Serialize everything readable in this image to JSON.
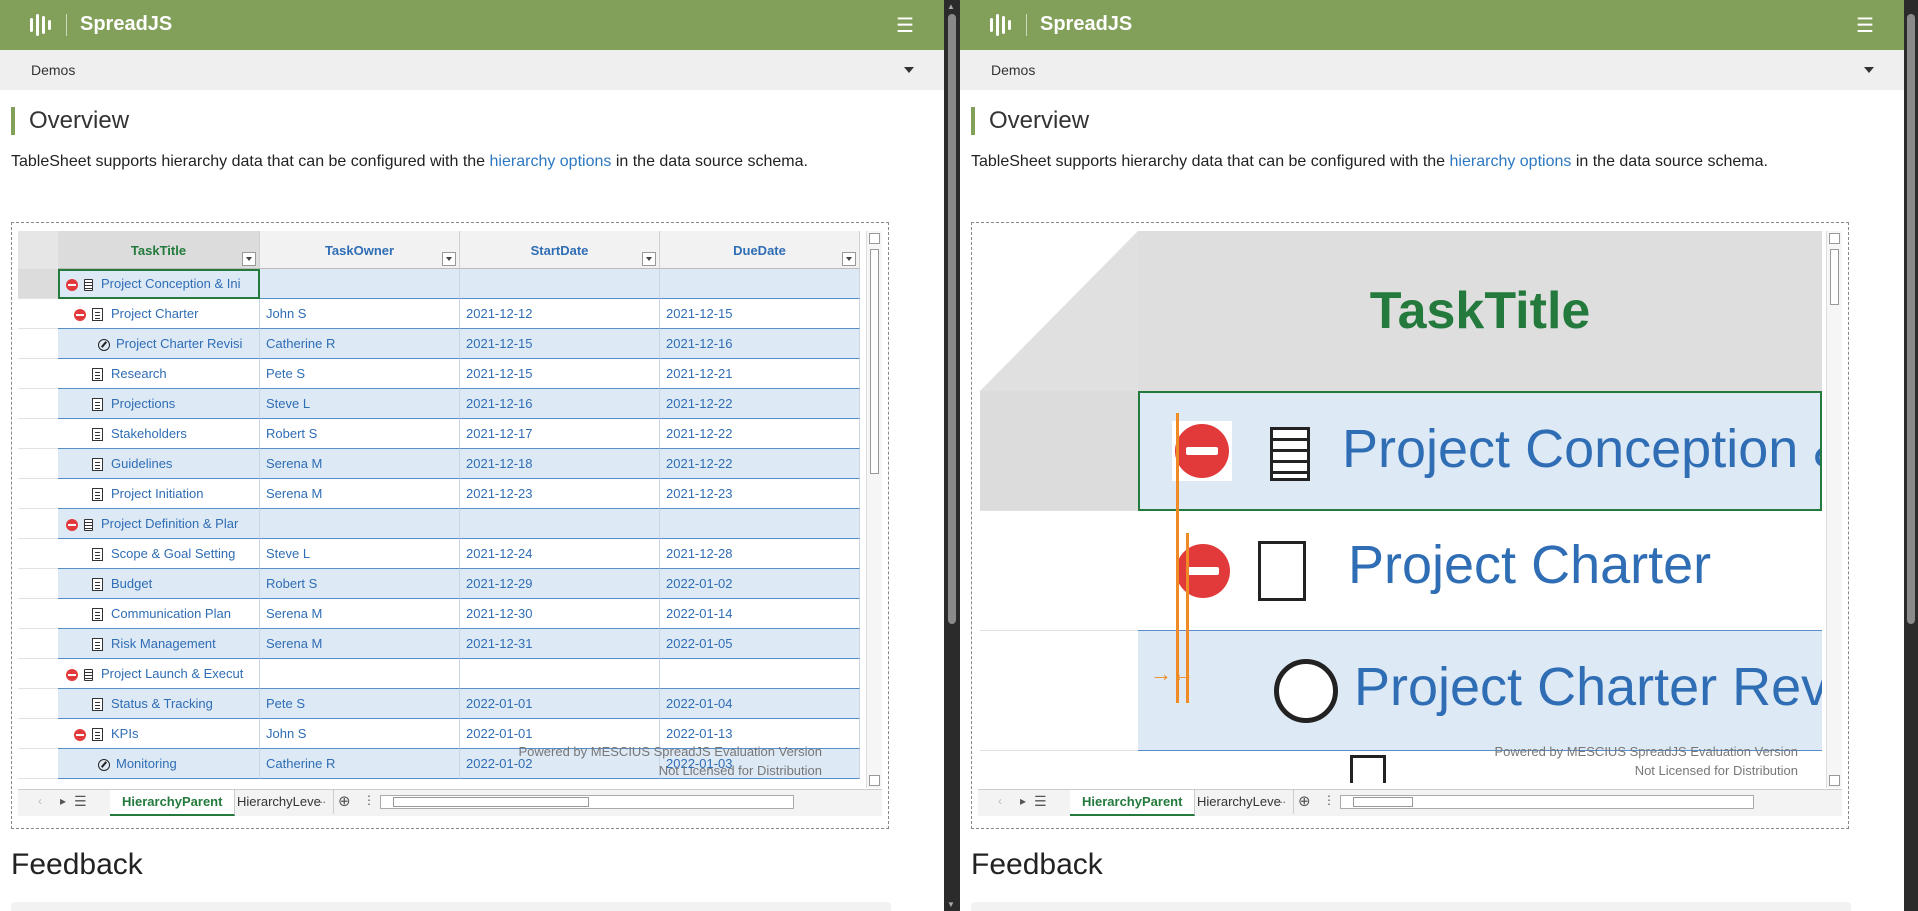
{
  "app": {
    "brand": "SpreadJS",
    "demos_label": "Demos"
  },
  "page": {
    "overview_title": "Overview",
    "desc_before": "TableSheet supports hierarchy data that can be configured with the ",
    "desc_link": "hierarchy options",
    "desc_after": " in the data source schema.",
    "feedback_title": "Feedback"
  },
  "grid": {
    "columns": [
      "TaskTitle",
      "TaskOwner",
      "StartDate",
      "DueDate"
    ],
    "rows": [
      {
        "level": 0,
        "title": "Project Conception & Ini",
        "owner": "",
        "start": "",
        "due": ""
      },
      {
        "level": 1,
        "title": "Project Charter",
        "owner": "John S",
        "start": "2021-12-12",
        "due": "2021-12-15"
      },
      {
        "level": 2,
        "title": "Project Charter Revisi",
        "owner": "Catherine R",
        "start": "2021-12-15",
        "due": "2021-12-16"
      },
      {
        "level": 1,
        "title": "Research",
        "owner": "Pete S",
        "start": "2021-12-15",
        "due": "2021-12-21"
      },
      {
        "level": 1,
        "title": "Projections",
        "owner": "Steve L",
        "start": "2021-12-16",
        "due": "2021-12-22"
      },
      {
        "level": 1,
        "title": "Stakeholders",
        "owner": "Robert S",
        "start": "2021-12-17",
        "due": "2021-12-22"
      },
      {
        "level": 1,
        "title": "Guidelines",
        "owner": "Serena M",
        "start": "2021-12-18",
        "due": "2021-12-22"
      },
      {
        "level": 1,
        "title": "Project Initiation",
        "owner": "Serena M",
        "start": "2021-12-23",
        "due": "2021-12-23"
      },
      {
        "level": 0,
        "title": "Project Definition & Plar",
        "owner": "",
        "start": "",
        "due": ""
      },
      {
        "level": 1,
        "title": "Scope & Goal Setting",
        "owner": "Steve L",
        "start": "2021-12-24",
        "due": "2021-12-28"
      },
      {
        "level": 1,
        "title": "Budget",
        "owner": "Robert S",
        "start": "2021-12-29",
        "due": "2022-01-02"
      },
      {
        "level": 1,
        "title": "Communication Plan",
        "owner": "Serena M",
        "start": "2021-12-30",
        "due": "2022-01-14"
      },
      {
        "level": 1,
        "title": "Risk Management",
        "owner": "Serena M",
        "start": "2021-12-31",
        "due": "2022-01-05"
      },
      {
        "level": 0,
        "title": "Project Launch & Execut",
        "owner": "",
        "start": "",
        "due": ""
      },
      {
        "level": 1,
        "title": "Status & Tracking",
        "owner": "Pete S",
        "start": "2022-01-01",
        "due": "2022-01-04"
      },
      {
        "level": 1,
        "title": "KPIs",
        "owner": "John S",
        "start": "2022-01-01",
        "due": "2022-01-13"
      },
      {
        "level": 2,
        "title": "Monitoring",
        "owner": "Catherine R",
        "start": "2022-01-02",
        "due": "2022-01-03"
      }
    ]
  },
  "watermark": {
    "line1": "Powered by MESCIUS SpreadJS Evaluation Version",
    "line2": "Not Licensed for Distribution"
  },
  "tabs": {
    "active": "HierarchyParent",
    "other": "HierarchyLeve",
    "more": "..."
  },
  "zoom": {
    "header": "TaskTitle",
    "row1": "Project Conception &",
    "row2": "Project Charter",
    "row3": "Project Charter Revi"
  },
  "colors": {
    "header_bg": "#82a05a",
    "accent_green": "#237a3c",
    "link_blue": "#2f6db5",
    "alt_row": "#dde9f5"
  },
  "icons": [
    "logo-icon",
    "hamburger-menu-icon",
    "chevron-down-icon",
    "collapse-minus-icon",
    "clipboard-icon",
    "document-edit-icon",
    "pencil-circle-icon",
    "add-sheet-icon"
  ]
}
